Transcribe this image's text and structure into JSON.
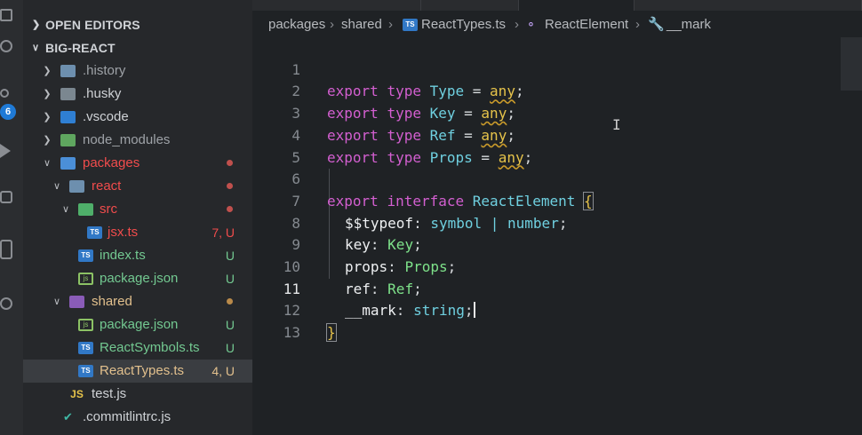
{
  "sidebar": {
    "open_editors_label": "OPEN EDITORS",
    "project_label": "BIG-REACT",
    "items": [
      {
        "name": ".history",
        "status": ""
      },
      {
        "name": ".husky",
        "status": ""
      },
      {
        "name": ".vscode",
        "status": ""
      },
      {
        "name": "node_modules",
        "status": ""
      },
      {
        "name": "packages",
        "status": ""
      },
      {
        "name": "react",
        "status": ""
      },
      {
        "name": "src",
        "status": ""
      },
      {
        "name": "jsx.ts",
        "status": "7, U"
      },
      {
        "name": "index.ts",
        "status": "U"
      },
      {
        "name": "package.json",
        "status": "U"
      },
      {
        "name": "shared",
        "status": ""
      },
      {
        "name": "package.json",
        "status": "U"
      },
      {
        "name": "ReactSymbols.ts",
        "status": "U"
      },
      {
        "name": "ReactTypes.ts",
        "status": "4, U"
      },
      {
        "name": "test.js",
        "status": ""
      },
      {
        "name": ".commitlintrc.js",
        "status": ""
      }
    ],
    "activity_badge": "6"
  },
  "breadcrumb": {
    "packages": "packages",
    "shared": "shared",
    "file": "ReactTypes.ts",
    "interface": "ReactElement",
    "field": "__mark"
  },
  "code": {
    "line_numbers": [
      "1",
      "2",
      "3",
      "4",
      "5",
      "6",
      "7",
      "8",
      "9",
      "10",
      "11",
      "12",
      "13"
    ],
    "active_line": "11",
    "kw_export": "export",
    "kw_type": "type",
    "kw_interface": "interface",
    "kw_any": "any",
    "type_names": [
      "Type",
      "Key",
      "Ref",
      "Props"
    ],
    "interface_name": "ReactElement",
    "fields": [
      {
        "name": "$$typeof",
        "type": "symbol | number"
      },
      {
        "name": "key",
        "type": "Key"
      },
      {
        "name": "props",
        "type": "Props"
      },
      {
        "name": "ref",
        "type": "Ref"
      },
      {
        "name": "__mark",
        "type": "string"
      }
    ],
    "open_brace": "{",
    "close_brace": "}",
    "equals": " = ",
    "semicolon": ";",
    "colon": ": "
  },
  "colors": {
    "keyword": "#d35fd0",
    "type_name": "#6fd0e0",
    "type_ref": "#7ee28a",
    "any": "#e6c34a",
    "untracked": "#73c991",
    "modified": "#e2c08d",
    "error_red": "#f14c4c"
  }
}
